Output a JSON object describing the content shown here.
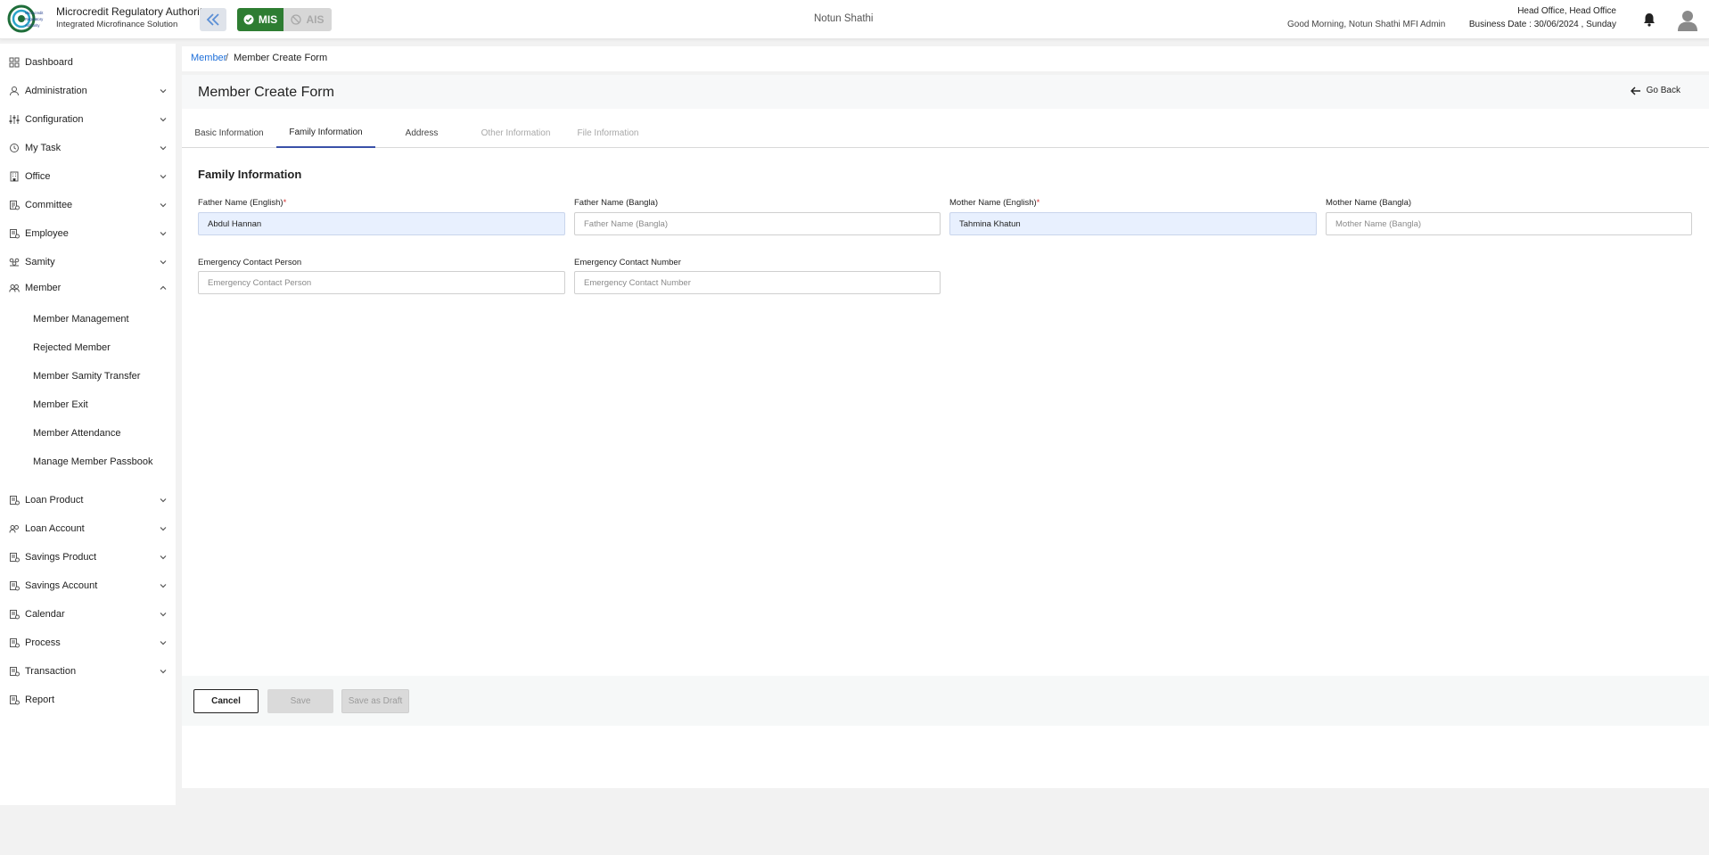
{
  "header": {
    "brand_title": "Microcredit Regulatory Authority",
    "brand_subtitle": "Integrated Microfinance Solution",
    "logo_text": [
      "Microcredit",
      "Regulatory",
      "Authority"
    ],
    "mis_label": "MIS",
    "ais_label": "AIS",
    "app_name": "Notun Shathi",
    "greeting": "Good Morning, Notun Shathi MFI Admin",
    "office": "Head Office, Head Office",
    "business_date": "Business Date : 30/06/2024 , Sunday",
    "colors": {
      "mis": "#2e7d32",
      "accent": "#1e6fd9"
    }
  },
  "sidebar": {
    "items": [
      {
        "label": "Dashboard",
        "icon": "grid-icon",
        "expandable": false
      },
      {
        "label": "Administration",
        "icon": "admin-icon",
        "expandable": true
      },
      {
        "label": "Configuration",
        "icon": "sliders-icon",
        "expandable": true
      },
      {
        "label": "My Task",
        "icon": "task-icon",
        "expandable": true
      },
      {
        "label": "Office",
        "icon": "office-icon",
        "expandable": true
      },
      {
        "label": "Committee",
        "icon": "committee-icon",
        "expandable": true
      },
      {
        "label": "Employee",
        "icon": "employee-icon",
        "expandable": true
      },
      {
        "label": "Samity",
        "icon": "samity-icon",
        "expandable": true
      },
      {
        "label": "Member",
        "icon": "member-icon",
        "expandable": true,
        "expanded": true
      },
      {
        "label": "Loan Product",
        "icon": "loan-product-icon",
        "expandable": true
      },
      {
        "label": "Loan Account",
        "icon": "loan-account-icon",
        "expandable": true
      },
      {
        "label": "Savings Product",
        "icon": "savings-product-icon",
        "expandable": true
      },
      {
        "label": "Savings Account",
        "icon": "savings-account-icon",
        "expandable": true
      },
      {
        "label": "Calendar",
        "icon": "calendar-icon",
        "expandable": true
      },
      {
        "label": "Process",
        "icon": "process-icon",
        "expandable": true
      },
      {
        "label": "Transaction",
        "icon": "transaction-icon",
        "expandable": true
      },
      {
        "label": "Report",
        "icon": "report-icon",
        "expandable": false
      }
    ],
    "member_subitems": [
      "Member Management",
      "Rejected Member",
      "Member Samity Transfer",
      "Member Exit",
      "Member Attendance",
      "Manage Member Passbook"
    ]
  },
  "breadcrumb": {
    "parent": "Member",
    "separator": "/",
    "current": "Member Create Form"
  },
  "page": {
    "title": "Member Create Form",
    "go_back": "Go Back"
  },
  "tabs": [
    {
      "label": "Basic Information",
      "state": "normal"
    },
    {
      "label": "Family Information",
      "state": "active"
    },
    {
      "label": "Address",
      "state": "normal"
    },
    {
      "label": "Other Information",
      "state": "disabled"
    },
    {
      "label": "File Information",
      "state": "disabled"
    }
  ],
  "form": {
    "section_title": "Family Information",
    "fields": {
      "father_en": {
        "label": "Father Name (English)",
        "required": true,
        "value": "Abdul Hannan",
        "placeholder": "Father Name (English)"
      },
      "father_bn": {
        "label": "Father Name (Bangla)",
        "required": false,
        "value": "",
        "placeholder": "Father Name (Bangla)"
      },
      "mother_en": {
        "label": "Mother Name (English)",
        "required": true,
        "value": "Tahmina Khatun",
        "placeholder": "Mother Name (English)"
      },
      "mother_bn": {
        "label": "Mother Name (Bangla)",
        "required": false,
        "value": "",
        "placeholder": "Mother Name (Bangla)"
      },
      "emergency_person": {
        "label": "Emergency Contact Person",
        "required": false,
        "value": "",
        "placeholder": "Emergency Contact Person"
      },
      "emergency_number": {
        "label": "Emergency Contact Number",
        "required": false,
        "value": "",
        "placeholder": "Emergency Contact Number"
      }
    },
    "required_mark": "*"
  },
  "actions": {
    "cancel": "Cancel",
    "save": "Save",
    "save_draft": "Save as Draft"
  }
}
